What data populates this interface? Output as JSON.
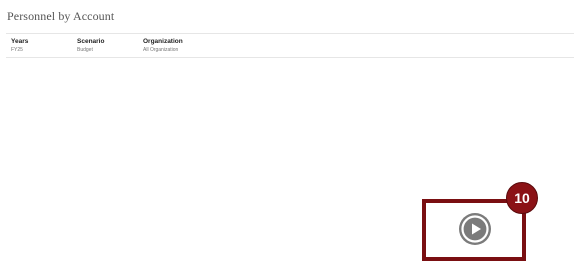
{
  "page": {
    "title": "Personnel by Account"
  },
  "pov": {
    "years": {
      "label": "Years",
      "value": "FY25"
    },
    "scenario": {
      "label": "Scenario",
      "value": "Budget"
    },
    "organization": {
      "label": "Organization",
      "value": "All Organization"
    }
  },
  "callout": {
    "step_number": "10",
    "frame_color": "#7a0f12",
    "badge_color": "#8b1216",
    "play_icon": "play-icon"
  }
}
